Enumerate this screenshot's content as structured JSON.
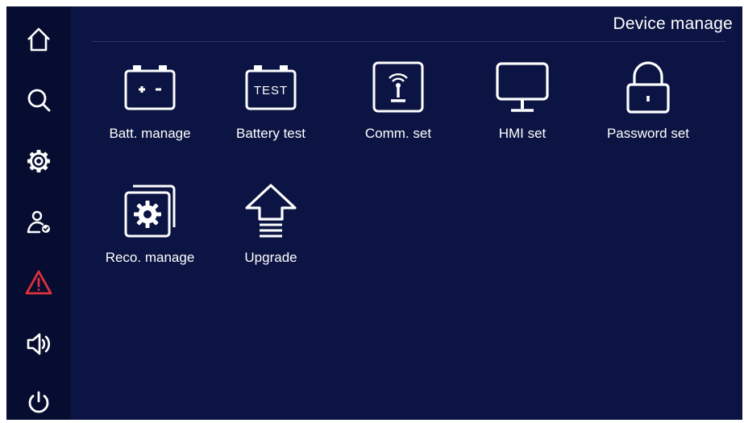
{
  "header": {
    "title": "Device manage"
  },
  "sidebar": {
    "items": [
      {
        "icon": "home-icon"
      },
      {
        "icon": "search-icon"
      },
      {
        "icon": "gear-icon"
      },
      {
        "icon": "user-check-icon"
      },
      {
        "icon": "alarm-warning-icon",
        "color": "#e0313b"
      },
      {
        "icon": "speaker-icon"
      },
      {
        "icon": "power-icon"
      }
    ]
  },
  "menu": {
    "items": [
      {
        "label": "Batt. manage",
        "icon": "battery-icon"
      },
      {
        "label": "Battery test",
        "icon": "battery-test-icon",
        "badge": "TEST"
      },
      {
        "label": "Comm. set",
        "icon": "antenna-icon"
      },
      {
        "label": "HMI set",
        "icon": "monitor-icon"
      },
      {
        "label": "Password set",
        "icon": "lock-icon"
      },
      {
        "label": "Reco. manage",
        "icon": "record-gear-icon"
      },
      {
        "label": "Upgrade",
        "icon": "upgrade-arrow-icon"
      }
    ]
  },
  "colors": {
    "background": "#0b1442",
    "sidebar": "#070d30",
    "foreground": "#ffffff",
    "alert": "#e0313b"
  }
}
